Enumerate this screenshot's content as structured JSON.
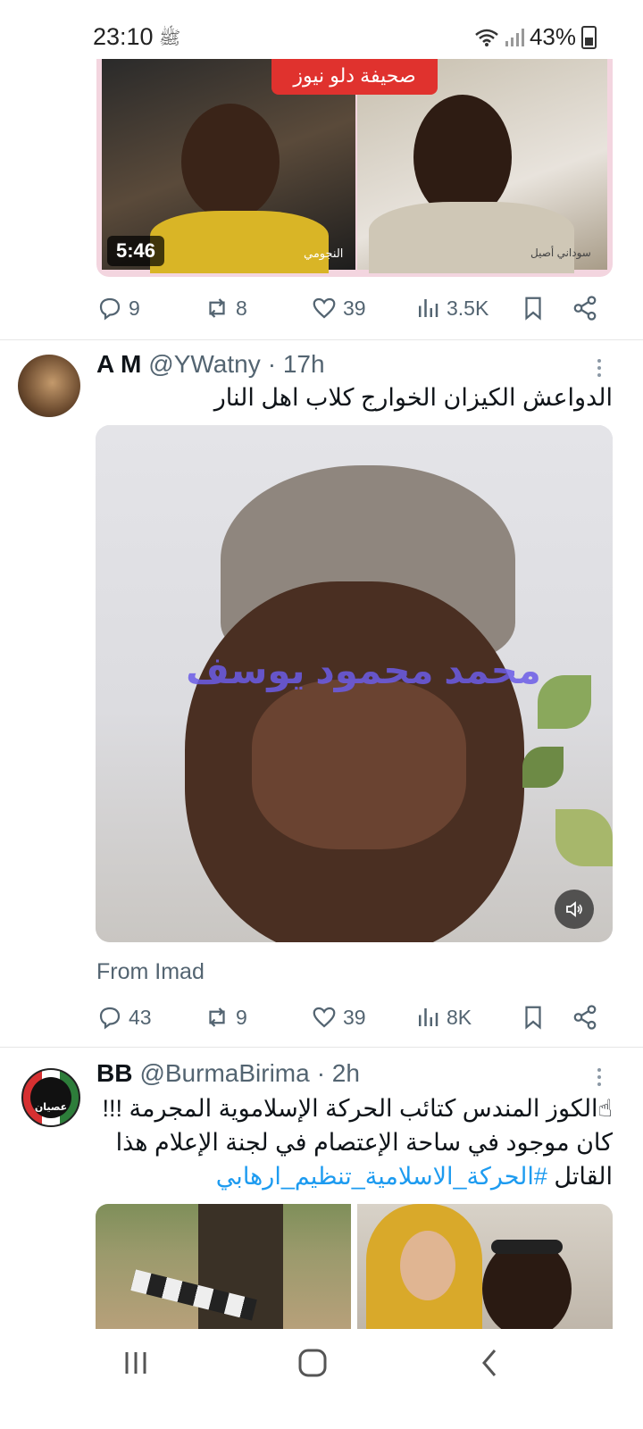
{
  "status_bar": {
    "time": "23:10",
    "battery": "43%",
    "icons": [
      "blessing-icon",
      "wifi-icon",
      "signal-icon",
      "battery-icon"
    ]
  },
  "tweets": [
    {
      "media": {
        "banner_text": "صحيفة دلو نيوز",
        "duration": "5:46",
        "overlay_label_left": "النجومي",
        "overlay_label_right": "سوداني أصيل"
      },
      "actions": {
        "replies": "9",
        "reposts": "8",
        "likes": "39",
        "views": "3.5K"
      }
    },
    {
      "name": "A M",
      "handle": "@YWatny",
      "time": "· 17h",
      "text": "الدواعش الكيزان الخوارج كلاب اهل النار",
      "media": {
        "watermark": "محمد محمود يوسف"
      },
      "source": "From Imad",
      "actions": {
        "replies": "43",
        "reposts": "9",
        "likes": "39",
        "views": "8K"
      }
    },
    {
      "name": "BB",
      "handle": "@BurmaBirima",
      "time": "· 2h",
      "text_line1": "☝الكوز المندس كتائب الحركة الإسلاموية المجرمة !!!",
      "text_line2": "كان موجود في ساحة الإعتصام  في لجنة الإعلام هذا",
      "text_line3_prefix": "القاتل ",
      "hashtag": "#الحركة_الاسلامية_تنظيم_ارهابي",
      "avatar_text": "عصيان"
    }
  ],
  "nav_bar": {
    "items": [
      "recents-button",
      "home-button",
      "back-button"
    ]
  }
}
